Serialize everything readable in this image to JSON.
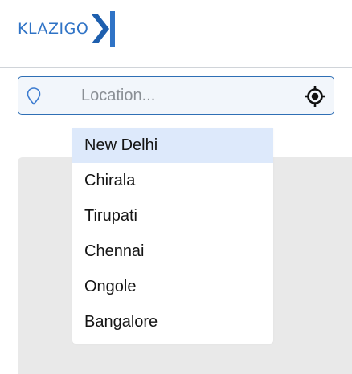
{
  "header": {
    "logo_text": "KLAZIGO"
  },
  "search": {
    "placeholder": "Location...",
    "value": "",
    "pin_icon": "map-pin-icon",
    "gps_icon": "gps-target-icon"
  },
  "dropdown": {
    "items": [
      {
        "label": "New Delhi",
        "highlighted": true
      },
      {
        "label": "Chirala"
      },
      {
        "label": "Tirupati"
      },
      {
        "label": "Chennai"
      },
      {
        "label": "Ongole"
      },
      {
        "label": "Bangalore"
      }
    ]
  },
  "colors": {
    "brand": "#2f73c6",
    "input_border": "#2f6fb5",
    "input_bg": "#f2f6fb",
    "highlight": "#dde9fb",
    "map_bg": "#e9e9e9"
  }
}
